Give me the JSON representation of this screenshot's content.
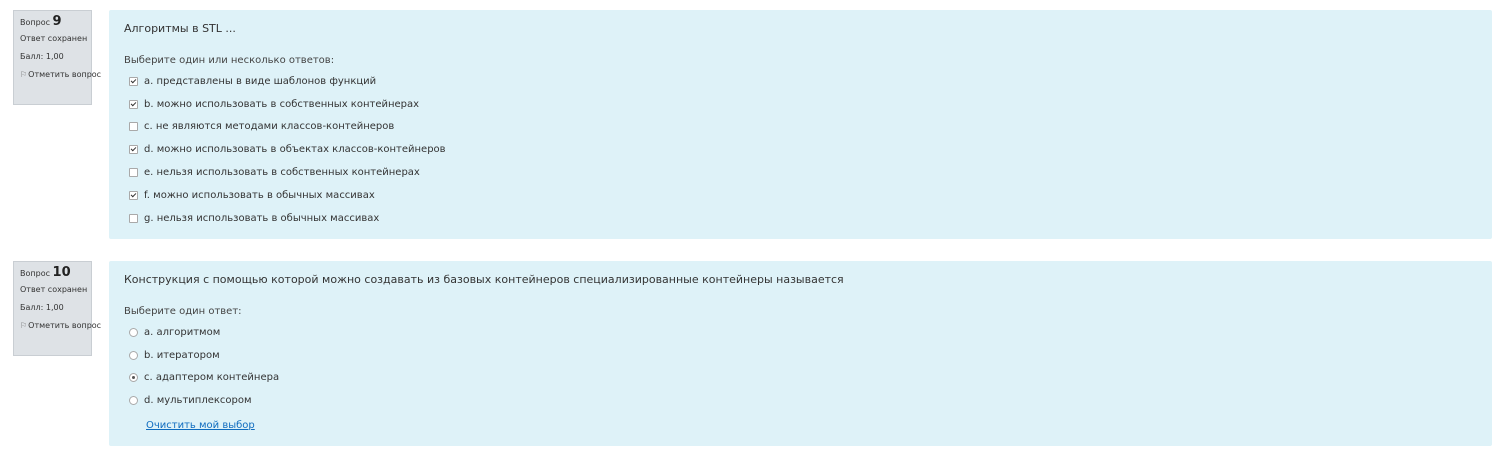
{
  "q9": {
    "label": "Вопрос",
    "number": "9",
    "status": "Ответ сохранен",
    "grade": "Балл: 1,00",
    "flag": "Отметить вопрос",
    "text": "Алгоритмы в STL ...",
    "prompt": "Выберите один или несколько ответов:",
    "answers": [
      {
        "text": "a. представлены в виде шаблонов функций",
        "checked": true
      },
      {
        "text": "b. можно использовать в собственных контейнерах",
        "checked": true
      },
      {
        "text": "c. не являются методами классов-контейнеров",
        "checked": false
      },
      {
        "text": "d. можно использовать в объектах классов-контейнеров",
        "checked": true
      },
      {
        "text": "e. нельзя использовать в собственных контейнерах",
        "checked": false
      },
      {
        "text": "f. можно использовать в обычных массивах",
        "checked": true
      },
      {
        "text": "g. нельзя использовать в обычных массивах",
        "checked": false
      }
    ]
  },
  "q10": {
    "label": "Вопрос",
    "number": "10",
    "status": "Ответ сохранен",
    "grade": "Балл: 1,00",
    "flag": "Отметить вопрос",
    "text": "Конструкция с помощью которой можно создавать из базовых контейнеров специализированные контейнеры называется",
    "prompt": "Выберите один ответ:",
    "answers": [
      {
        "text": "a. алгоритмом",
        "checked": false
      },
      {
        "text": "b. итератором",
        "checked": false
      },
      {
        "text": "c. адаптером контейнера",
        "checked": true
      },
      {
        "text": "d. мультиплексором",
        "checked": false
      }
    ],
    "clear": "Очистить мой выбор"
  }
}
